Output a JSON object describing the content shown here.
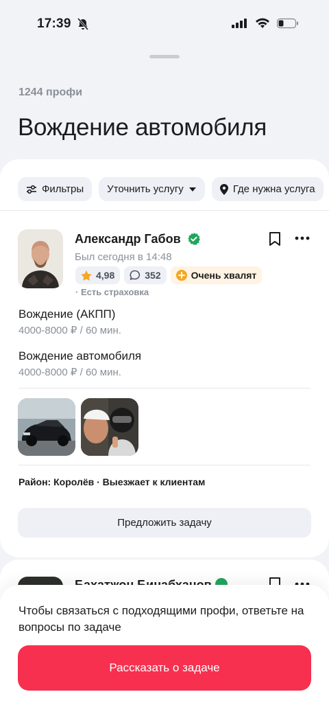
{
  "status_bar": {
    "time": "17:39"
  },
  "header": {
    "count": "1244 профи",
    "title": "Вождение автомобиля"
  },
  "filters": [
    {
      "label": "Фильтры",
      "icon": "sliders-icon"
    },
    {
      "label": "Уточнить услугу",
      "icon": "caret-down-icon"
    },
    {
      "label": "Где нужна услуга",
      "icon": "location-pin-icon"
    }
  ],
  "card": {
    "name": "Александр Габов",
    "last_seen": "Был сегодня в 14:48",
    "rating": "4,98",
    "reviews": "352",
    "praise": "Очень хвалят",
    "insurance": "· Есть страховка",
    "services": [
      {
        "name": "Вождение (АКПП)",
        "price": "4000-8000 ₽ / 60 мин."
      },
      {
        "name": "Вождение автомобиля",
        "price": "4000-8000 ₽ / 60 мин."
      }
    ],
    "region": "Район: Королёв · Выезжает к клиентам",
    "propose_button": "Предложить задачу"
  },
  "next_card": {
    "name": "Бахатжон Бинабханов"
  },
  "bottom_sheet": {
    "prompt": "Чтобы связаться с подходящими профи, ответьте на вопросы по задаче",
    "cta": "Рассказать о задаче"
  },
  "colors": {
    "accent": "#f7304f",
    "verified": "#22a55b",
    "star": "#f5a623"
  }
}
